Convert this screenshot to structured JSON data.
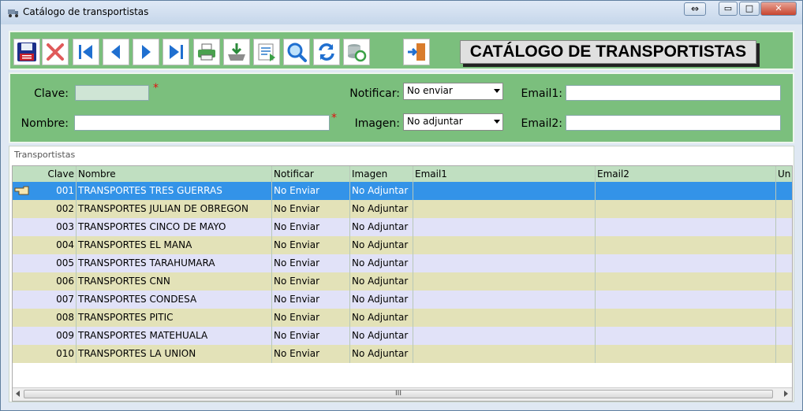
{
  "window": {
    "title": "Catálogo de transportistas",
    "controls": {
      "resize": "⇔",
      "minimize": "▭",
      "maximize": "□",
      "close": "✕"
    }
  },
  "toolbar": {
    "buttons": [
      {
        "name": "save",
        "icon": "floppy-disk-icon"
      },
      {
        "name": "cancel",
        "icon": "red-x-icon"
      },
      {
        "name": "first",
        "icon": "first-record-icon"
      },
      {
        "name": "previous",
        "icon": "previous-record-icon"
      },
      {
        "name": "next",
        "icon": "next-record-icon"
      },
      {
        "name": "last",
        "icon": "last-record-icon"
      },
      {
        "name": "print",
        "icon": "printer-icon"
      },
      {
        "name": "download",
        "icon": "download-tray-icon"
      },
      {
        "name": "export",
        "icon": "export-sheet-icon"
      },
      {
        "name": "search",
        "icon": "magnifier-icon"
      },
      {
        "name": "refresh",
        "icon": "refresh-icon"
      },
      {
        "name": "sync",
        "icon": "database-sync-icon"
      },
      {
        "name": "exit",
        "icon": "exit-door-icon"
      }
    ],
    "header_title": "CATÁLOGO DE TRANSPORTISTAS"
  },
  "form": {
    "clave_label": "Clave:",
    "clave_value": "",
    "nombre_label": "Nombre:",
    "nombre_value": "",
    "required_mark": "*",
    "notificar_label": "Notificar:",
    "notificar_value": "No enviar",
    "imagen_label": "Imagen:",
    "imagen_value": "No adjuntar",
    "email1_label": "Email1:",
    "email1_value": "",
    "email2_label": "Email2:",
    "email2_value": ""
  },
  "grid": {
    "caption": "Transportistas",
    "columns": [
      "Clave",
      "Nombre",
      "Notificar",
      "Imagen",
      "Email1",
      "Email2",
      "Un"
    ],
    "rows": [
      {
        "clave": "001",
        "nombre": "TRANSPORTES TRES GUERRAS",
        "notificar": "No Enviar",
        "imagen": "No Adjuntar",
        "email1": "",
        "email2": ""
      },
      {
        "clave": "002",
        "nombre": "TRANSPORTES JULIAN DE OBREGON",
        "notificar": "No Enviar",
        "imagen": "No Adjuntar",
        "email1": "",
        "email2": ""
      },
      {
        "clave": "003",
        "nombre": "TRANSPORTES CINCO DE MAYO",
        "notificar": "No Enviar",
        "imagen": "No Adjuntar",
        "email1": "",
        "email2": ""
      },
      {
        "clave": "004",
        "nombre": "TRANSPORTES EL MANA",
        "notificar": "No Enviar",
        "imagen": "No Adjuntar",
        "email1": "",
        "email2": ""
      },
      {
        "clave": "005",
        "nombre": "TRANSPORTES TARAHUMARA",
        "notificar": "No Enviar",
        "imagen": "No Adjuntar",
        "email1": "",
        "email2": ""
      },
      {
        "clave": "006",
        "nombre": "TRANSPORTES CNN",
        "notificar": "No Enviar",
        "imagen": "No Adjuntar",
        "email1": "",
        "email2": ""
      },
      {
        "clave": "007",
        "nombre": "TRANSPORTES CONDESA",
        "notificar": "No Enviar",
        "imagen": "No Adjuntar",
        "email1": "",
        "email2": ""
      },
      {
        "clave": "008",
        "nombre": "TRANSPORTES PITIC",
        "notificar": "No Enviar",
        "imagen": "No Adjuntar",
        "email1": "",
        "email2": ""
      },
      {
        "clave": "009",
        "nombre": "TRANSPORTES MATEHUALA",
        "notificar": "No Enviar",
        "imagen": "No Adjuntar",
        "email1": "",
        "email2": ""
      },
      {
        "clave": "010",
        "nombre": "TRANSPORTES LA UNION",
        "notificar": "No Enviar",
        "imagen": "No Adjuntar",
        "email1": "",
        "email2": ""
      }
    ],
    "selected_row": 0,
    "scroll_thumb_grip": "III"
  },
  "colors": {
    "panel_green": "#7bbf7d",
    "header_green": "#c0dfc1",
    "row_lavender": "#e1e2f8",
    "row_khaki": "#e3e2b8",
    "selection_blue": "#3393e8",
    "required_red": "#e01010"
  }
}
